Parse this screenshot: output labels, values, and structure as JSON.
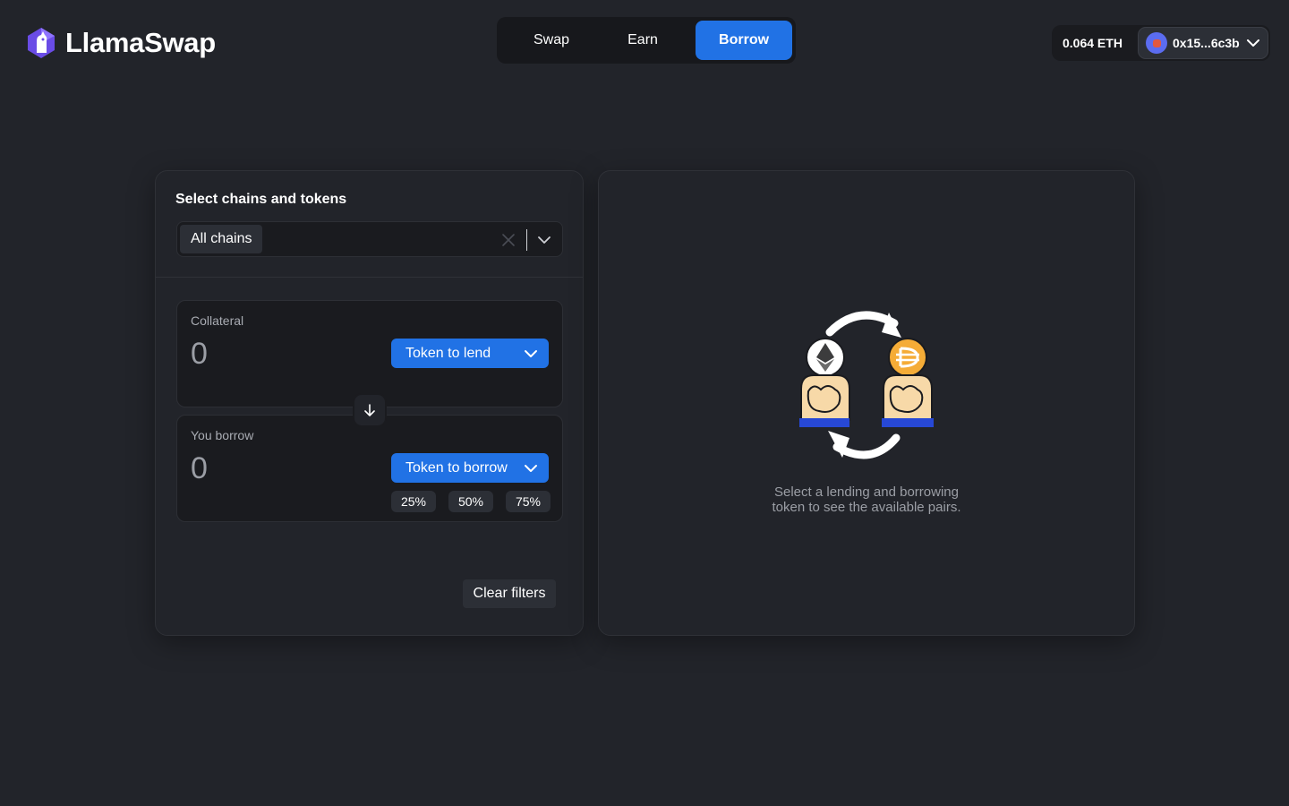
{
  "app": {
    "name": "LlamaSwap",
    "logo_icon": "llama-logo-icon"
  },
  "nav": {
    "tabs": [
      {
        "label": "Swap",
        "active": false
      },
      {
        "label": "Earn",
        "active": false
      },
      {
        "label": "Borrow",
        "active": true
      }
    ]
  },
  "wallet": {
    "balance": "0.064 ETH",
    "address": "0x15...6c3b",
    "avatar_icon": "wallet-avatar-icon",
    "chevron_icon": "chevron-down-icon"
  },
  "filters": {
    "title": "Select chains and tokens",
    "chain_value": "All chains",
    "clear_icon": "close-icon",
    "dropdown_icon": "chevron-down-icon"
  },
  "collateral": {
    "label": "Collateral",
    "amount": "0",
    "token_button": "Token to lend"
  },
  "borrow": {
    "label": "You borrow",
    "amount": "0",
    "token_button": "Token to borrow",
    "percent_options": [
      "25%",
      "50%",
      "75%"
    ]
  },
  "swap_direction_icon": "arrow-down-icon",
  "clear_filters_label": "Clear filters",
  "empty_state": {
    "line1": "Select a lending and borrowing",
    "line2": "token to see the available pairs.",
    "illustration_icon": "llamas-exchange-tokens-illustration"
  },
  "colors": {
    "background": "#22242a",
    "accent": "#2172e5",
    "surface": "#1a1b1f",
    "chip": "#2c2f36",
    "muted_text": "#9b9ea5"
  }
}
